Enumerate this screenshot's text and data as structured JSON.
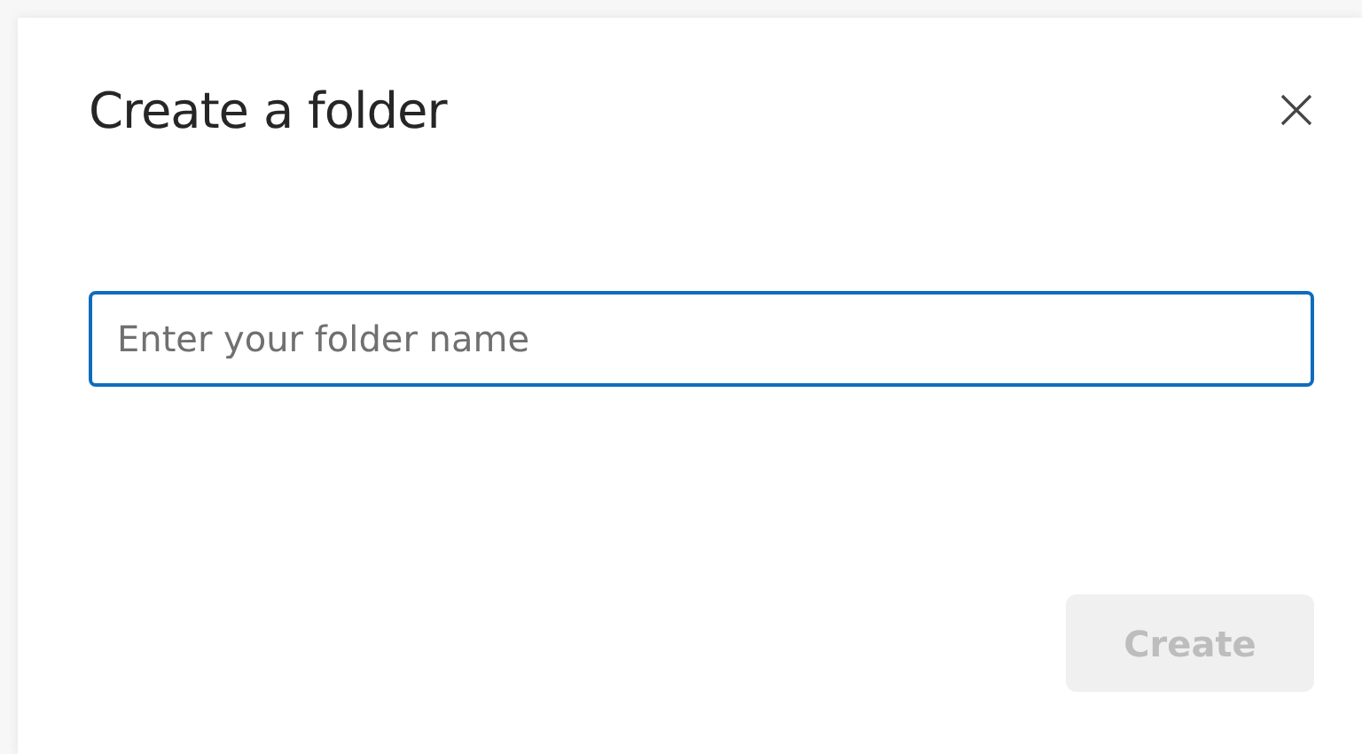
{
  "dialog": {
    "title": "Create a folder",
    "name_field": {
      "placeholder": "Enter your folder name",
      "focused": true
    },
    "buttons": [
      {
        "label": "Create",
        "disabled": true
      }
    ]
  }
}
